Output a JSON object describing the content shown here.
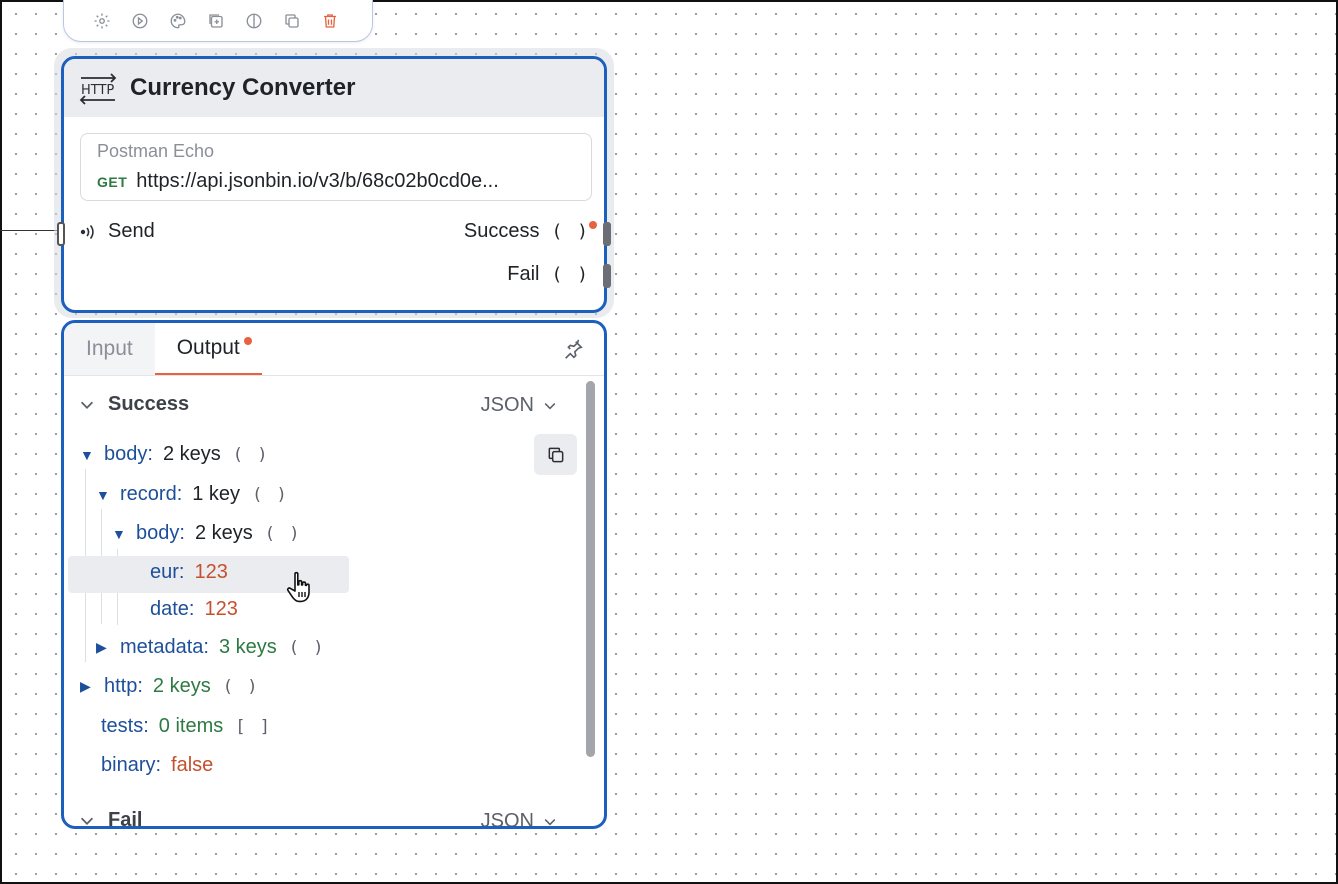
{
  "toolbar": {
    "icons": [
      "gear-icon",
      "play-clock-icon",
      "palette-icon",
      "add-node-icon",
      "toggle-icon",
      "duplicate-icon",
      "trash-icon"
    ],
    "trash_color": "#e8623f"
  },
  "node": {
    "icon": "http-icon",
    "title": "Currency Converter",
    "request": {
      "name": "Postman Echo",
      "method": "GET",
      "url": "https://api.jsonbin.io/v3/b/68c02b0cd0e..."
    },
    "input_port": {
      "label": "Send"
    },
    "output_ports": [
      {
        "label": "Success",
        "paren": "( )",
        "has_dot": true
      },
      {
        "label": "Fail",
        "paren": "( )",
        "has_dot": false
      }
    ]
  },
  "panel": {
    "tabs": [
      {
        "label": "Input",
        "active": false
      },
      {
        "label": "Output",
        "active": true,
        "has_dot": true
      }
    ],
    "sections": [
      {
        "title": "Success",
        "format": "JSON",
        "tree": {
          "body": {
            "key": "body:",
            "summary": "2 keys",
            "paren": "( )"
          },
          "record": {
            "key": "record:",
            "summary": "1 key",
            "paren": "( )"
          },
          "inner_body": {
            "key": "body:",
            "summary": "2 keys",
            "paren": "( )"
          },
          "eur": {
            "key": "eur:",
            "value": "123"
          },
          "date": {
            "key": "date:",
            "value": "123"
          },
          "metadata": {
            "key": "metadata:",
            "summary": "3 keys",
            "paren": "( )"
          },
          "http": {
            "key": "http:",
            "summary": "2 keys",
            "paren": "( )"
          },
          "tests": {
            "key": "tests:",
            "summary": "0 items",
            "paren": "[ ]"
          },
          "binary": {
            "key": "binary:",
            "value": "false"
          }
        }
      },
      {
        "title": "Fail",
        "format": "JSON"
      }
    ]
  },
  "colors": {
    "accent": "#1d5fbd",
    "notification": "#e8623f",
    "key": "#1d4f9a",
    "number": "#c4502e",
    "summary_green": "#2d7a42"
  }
}
